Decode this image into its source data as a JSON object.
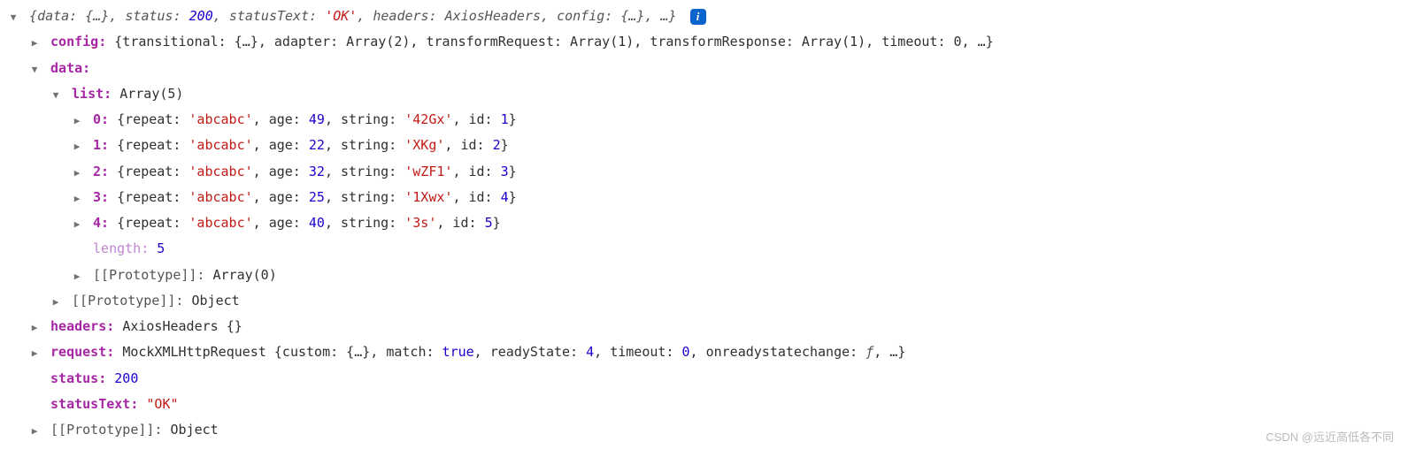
{
  "summary": {
    "open": "{",
    "data_k": "data:",
    "data_v": " {…}",
    "status_k": "status:",
    "status_v": "200",
    "statusText_k": "statusText:",
    "statusText_v": "'OK'",
    "headers_k": "headers:",
    "headers_v": "AxiosHeaders",
    "config_k": "config:",
    "config_v": " {…}",
    "ellipsis": "…",
    "close": "}",
    "info": "i"
  },
  "config": {
    "key": "config:",
    "value": " {transitional: {…}, adapter: Array(2), transformRequest: Array(1), transformResponse: Array(1), timeout: 0, …}"
  },
  "data": {
    "key": "data:",
    "list_key": "list:",
    "list_val": " Array(5)",
    "items": [
      {
        "idx": "0:",
        "open": " {repeat: ",
        "repeat": "'abcabc'",
        "age_k": ", age: ",
        "age": "49",
        "string_k": ", string: ",
        "string": "'42Gx'",
        "id_k": ", id: ",
        "id": "1",
        "close": "}"
      },
      {
        "idx": "1:",
        "open": " {repeat: ",
        "repeat": "'abcabc'",
        "age_k": ", age: ",
        "age": "22",
        "string_k": ", string: ",
        "string": "'XKg'",
        "id_k": ", id: ",
        "id": "2",
        "close": "}"
      },
      {
        "idx": "2:",
        "open": " {repeat: ",
        "repeat": "'abcabc'",
        "age_k": ", age: ",
        "age": "32",
        "string_k": ", string: ",
        "string": "'wZF1'",
        "id_k": ", id: ",
        "id": "3",
        "close": "}"
      },
      {
        "idx": "3:",
        "open": " {repeat: ",
        "repeat": "'abcabc'",
        "age_k": ", age: ",
        "age": "25",
        "string_k": ", string: ",
        "string": "'1Xwx'",
        "id_k": ", id: ",
        "id": "4",
        "close": "}"
      },
      {
        "idx": "4:",
        "open": " {repeat: ",
        "repeat": "'abcabc'",
        "age_k": ", age: ",
        "age": "40",
        "string_k": ", string: ",
        "string": "'3s'",
        "id_k": ", id: ",
        "id": "5",
        "close": "}"
      }
    ],
    "length_k": "length: ",
    "length_v": "5",
    "proto_arr_k": "[[Prototype]]:",
    "proto_arr_v": " Array(0)",
    "proto_obj_k": "[[Prototype]]:",
    "proto_obj_v": " Object"
  },
  "headers": {
    "key": "headers:",
    "value": " AxiosHeaders {}"
  },
  "request": {
    "key": "request:",
    "prefix": " MockXMLHttpRequest {custom: {…}, match: ",
    "match": "true",
    "ready_k": ", readyState: ",
    "ready_v": "4",
    "timeout_k": ", timeout: ",
    "timeout_v": "0",
    "onready_k": ", onreadystatechange: ",
    "onready_v": "ƒ",
    "suffix": ", …}"
  },
  "status": {
    "key": "status:",
    "value": " 200"
  },
  "statusText": {
    "key": "statusText:",
    "value": " \"OK\""
  },
  "proto": {
    "key": "[[Prototype]]:",
    "value": " Object"
  },
  "watermark": "CSDN @远近高低各不同"
}
